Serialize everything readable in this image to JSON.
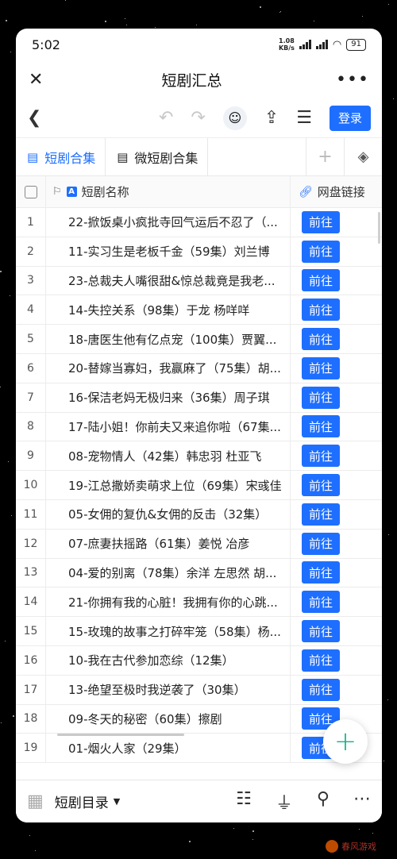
{
  "status": {
    "time": "5:02",
    "net_speed_top": "1.08",
    "net_speed_bottom": "KB/s",
    "battery": "91"
  },
  "titlebar": {
    "title": "短剧汇总"
  },
  "toolbar": {
    "login_label": "登录"
  },
  "tabs": [
    {
      "label": "短剧合集",
      "active": true
    },
    {
      "label": "微短剧合集",
      "active": false
    }
  ],
  "columns": {
    "name": "短剧名称",
    "link": "网盘链接"
  },
  "go_label": "前往",
  "rows": [
    {
      "idx": "1",
      "name": "22-掀饭桌小疯批寺回气运后不忍了（..."
    },
    {
      "idx": "2",
      "name": "11-实习生是老板千金（59集）刘兰博"
    },
    {
      "idx": "3",
      "name": "23-总裁夫人嘴很甜&惊总裁竟是我老..."
    },
    {
      "idx": "4",
      "name": "14-失控关系（98集）于龙 杨咩咩"
    },
    {
      "idx": "5",
      "name": "18-唐医生他有亿点宠（100集）贾翼..."
    },
    {
      "idx": "6",
      "name": "20-替嫁当寡妇，我赢麻了（75集）胡..."
    },
    {
      "idx": "7",
      "name": "16-保洁老妈无极归来（36集）周子琪"
    },
    {
      "idx": "8",
      "name": "17-陆小姐！你前夫又来追你啦（67集..."
    },
    {
      "idx": "9",
      "name": "08-宠物情人（42集）韩忠羽 杜亚飞"
    },
    {
      "idx": "10",
      "name": "19-江总撒娇卖萌求上位（69集）宋彧佳"
    },
    {
      "idx": "11",
      "name": "05-女佣的复仇&女佣的反击（32集）"
    },
    {
      "idx": "12",
      "name": "07-庶妻扶摇路（61集）姜悦 冶彦"
    },
    {
      "idx": "13",
      "name": "04-爱的别离（78集）余洋 左思然 胡..."
    },
    {
      "idx": "14",
      "name": "21-你拥有我的心脏！我拥有你的心跳..."
    },
    {
      "idx": "15",
      "name": "15-玫瑰的故事之打碎牢笼（58集）杨..."
    },
    {
      "idx": "16",
      "name": "10-我在古代参加恋综（12集）"
    },
    {
      "idx": "17",
      "name": "13-绝望至极时我逆袭了（30集）"
    },
    {
      "idx": "18",
      "name": "09-冬天的秘密（60集）擦剧"
    },
    {
      "idx": "19",
      "name": "01-烟火人家（29集）"
    }
  ],
  "bottombar": {
    "view_name": "短剧目录"
  },
  "watermark": "春风游戏"
}
